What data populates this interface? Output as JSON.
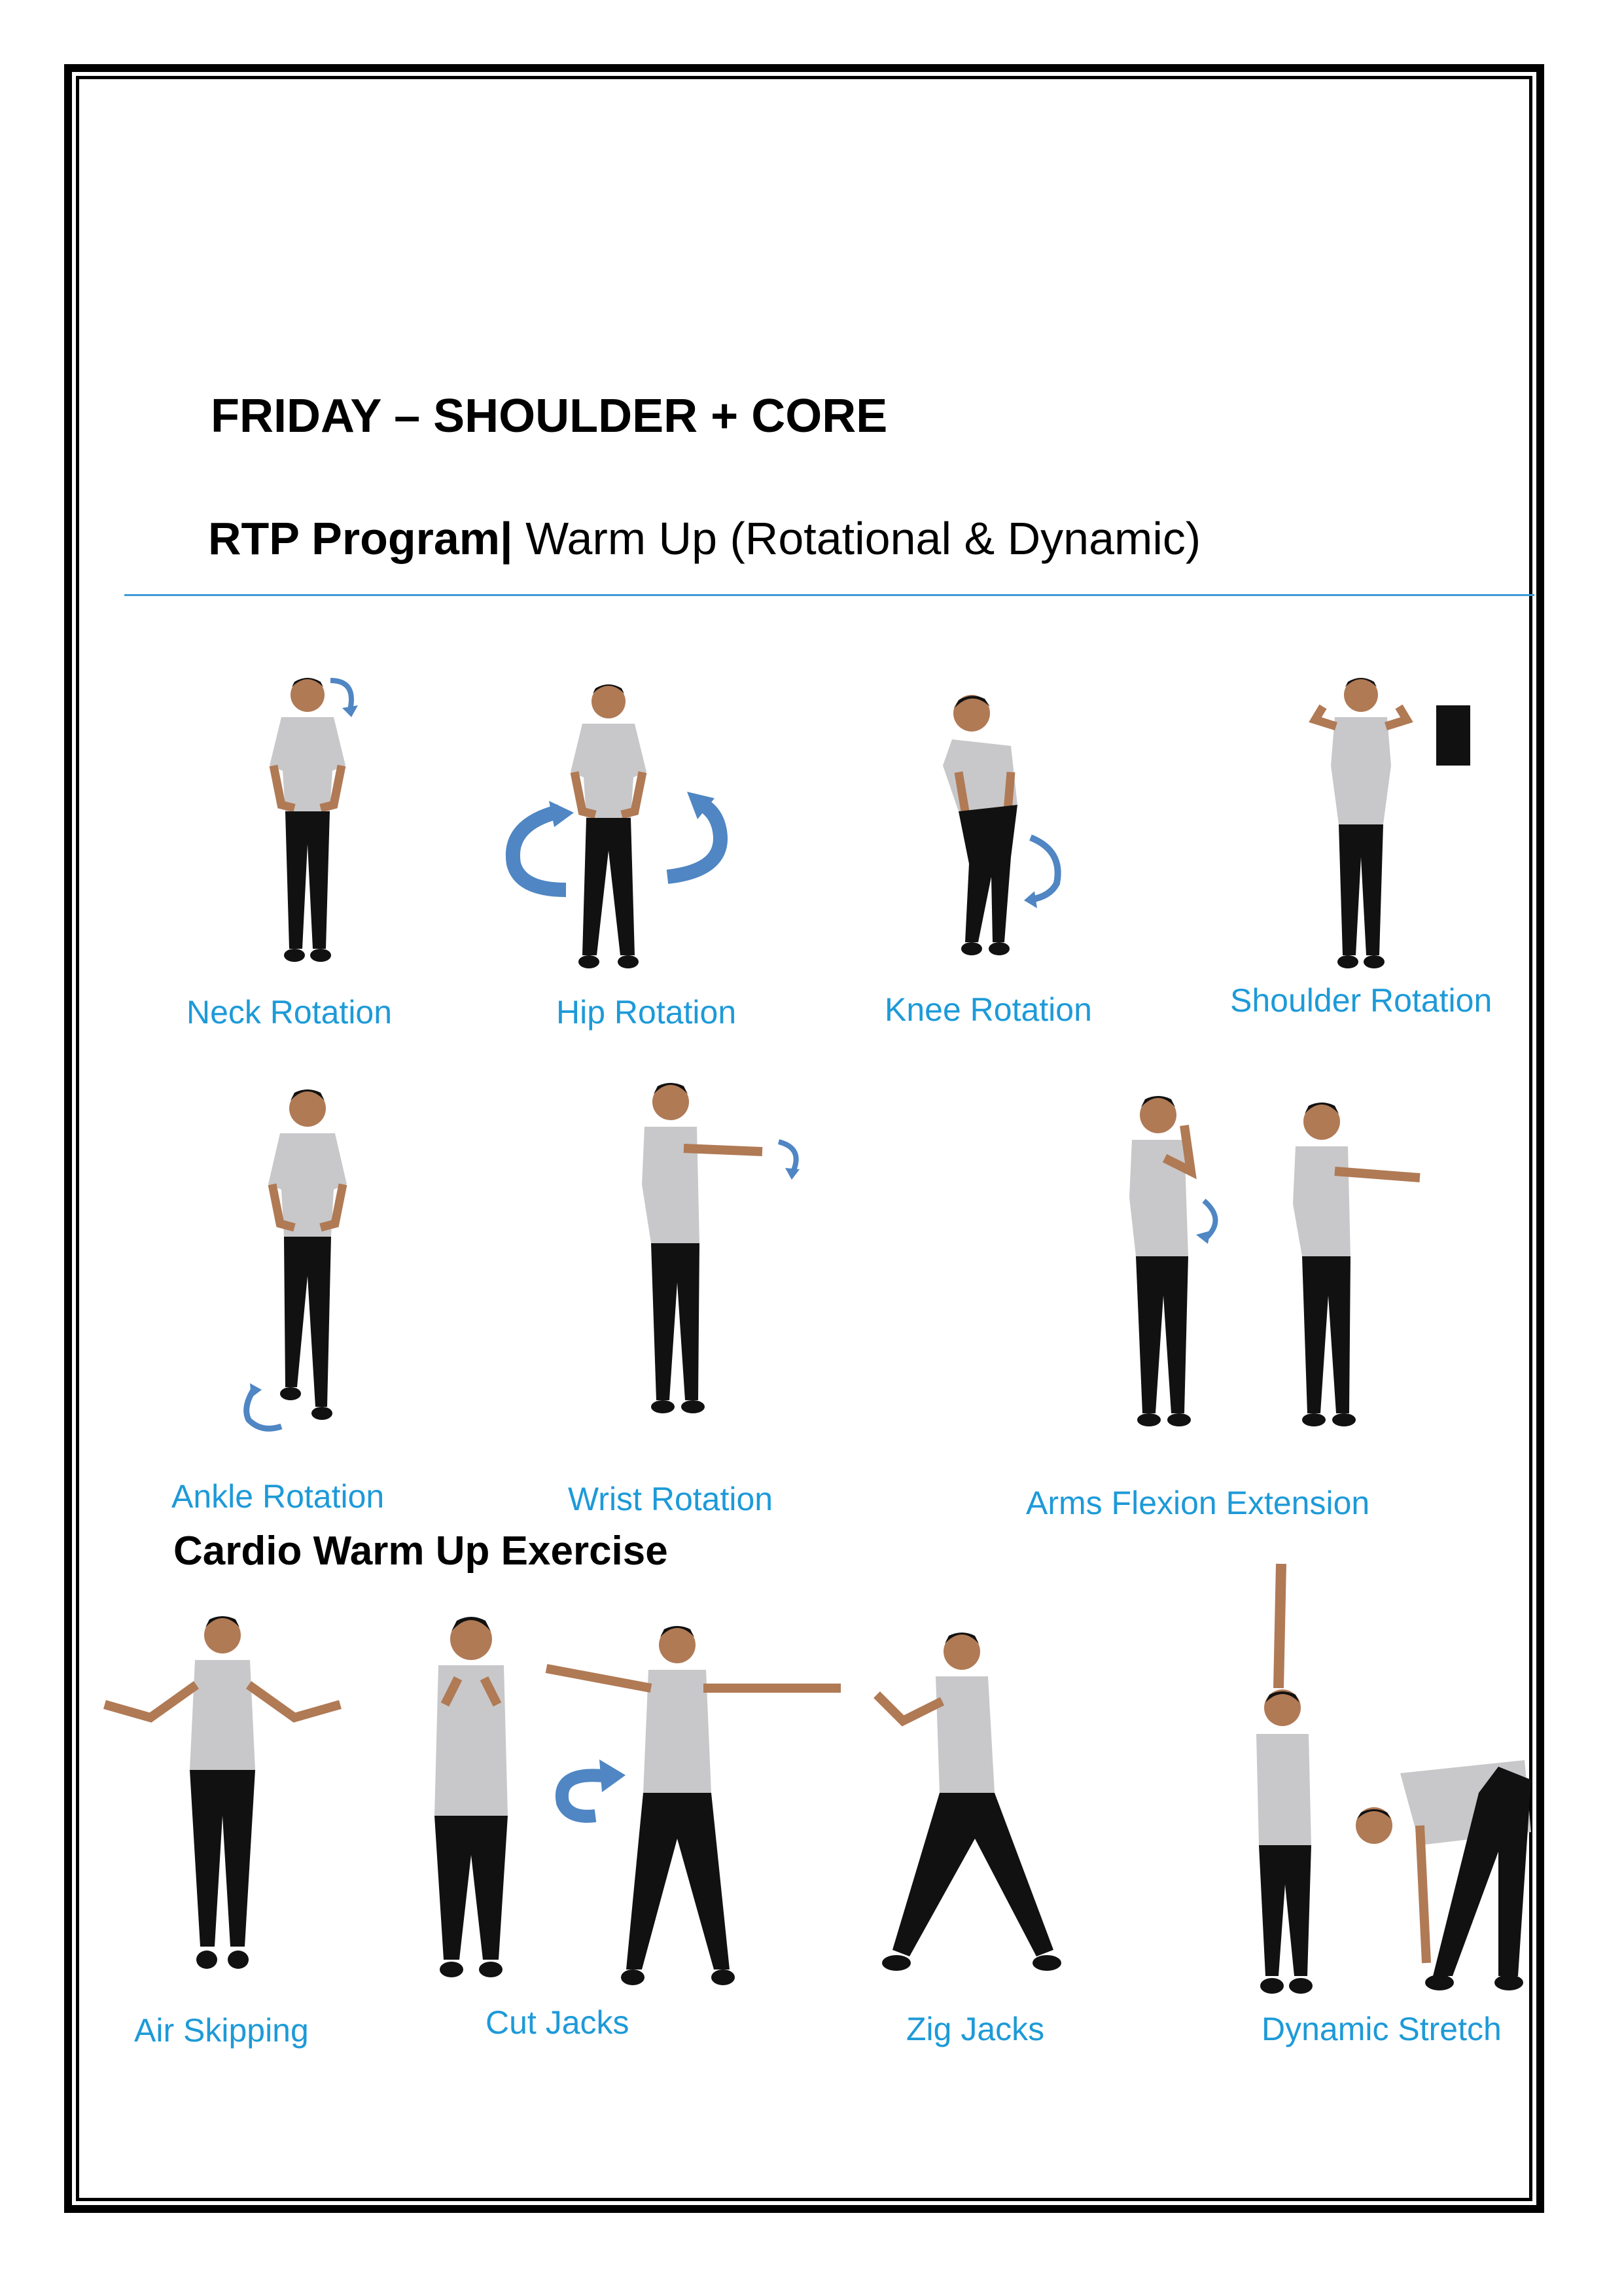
{
  "title": "FRIDAY – SHOULDER + CORE",
  "subtitle": {
    "bold": "RTP Program|",
    "normal": " Warm Up (Rotational & Dynamic)"
  },
  "cardio_heading": "Cardio Warm Up Exercise",
  "colors": {
    "label": "#1d9ad8",
    "rule": "#3c9ad6",
    "arrow": "#4f86c3",
    "shirt": "#c8c8ca",
    "pants": "#111111",
    "skin": "#b07a55"
  },
  "exercises": {
    "neck": "Neck Rotation",
    "hip": "Hip Rotation",
    "knee": "Knee Rotation",
    "shoulder": "Shoulder Rotation",
    "ankle": "Ankle Rotation",
    "wrist": "Wrist Rotation",
    "arms": "Arms Flexion Extension",
    "air": "Air Skipping",
    "cut": "Cut Jacks",
    "zig": "Zig Jacks",
    "dynamic": "Dynamic Stretch"
  }
}
